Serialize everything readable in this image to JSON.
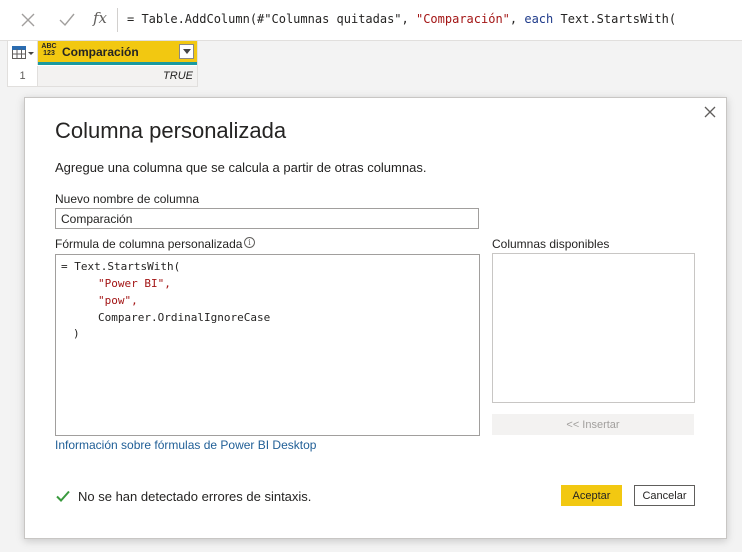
{
  "formula_bar": {
    "cancel_icon": "x-icon",
    "commit_icon": "check-icon",
    "fx_label": "fx",
    "formula_prefix": "= Table.AddColumn(#\"Columnas quitadas\", ",
    "formula_string": "\"Comparación\"",
    "formula_sep": ", ",
    "formula_keyword": "each",
    "formula_suffix": " Text.StartsWith("
  },
  "grid": {
    "table_icon": "table-icon",
    "column": {
      "type_label_top": "ABC",
      "type_label_bottom": "123",
      "name": "Comparación",
      "accent_color": "#f2c811",
      "quality_bar_color": "#1a9aa0"
    },
    "rows": [
      {
        "index": "1",
        "value": "TRUE"
      }
    ]
  },
  "dialog": {
    "title": "Columna personalizada",
    "description": "Agregue una columna que se calcula a partir de otras columnas.",
    "name_label": "Nuevo nombre de columna",
    "name_value": "Comparación",
    "formula_label": "Fórmula de columna personalizada",
    "info_icon": "info-icon",
    "formula_lines": {
      "l1": "= Text.StartsWith(",
      "l2": "\"Power BI\",",
      "l3": "\"pow\",",
      "l4": "Comparer.OrdinalIgnoreCase",
      "l5": ")"
    },
    "info_link": "Información sobre fórmulas de Power BI Desktop",
    "available_columns_label": "Columnas disponibles",
    "available_columns": [],
    "insert_label": "<< Insertar",
    "status_icon": "check-icon",
    "status_text": "No se han detectado errores de sintaxis.",
    "status_color": "#3a9a3e",
    "ok_label": "Aceptar",
    "cancel_label": "Cancelar",
    "close_icon": "close-icon"
  }
}
